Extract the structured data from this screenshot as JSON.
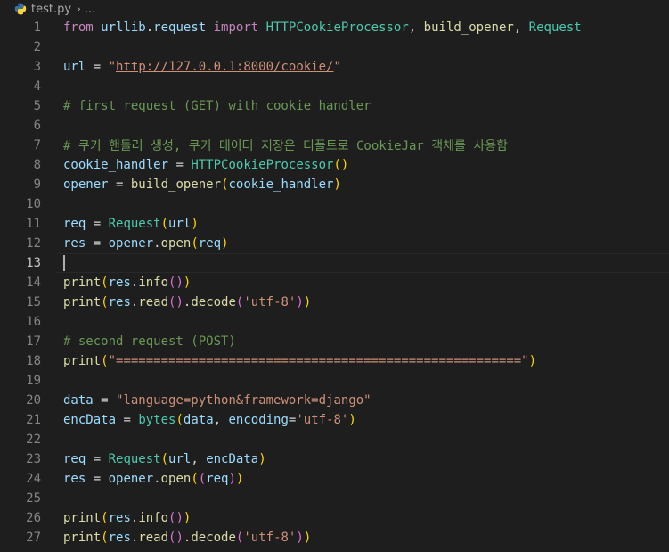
{
  "breadcrumb": {
    "file_name": "test.py",
    "separator": "›",
    "more": "..."
  },
  "theme": {
    "background": "#1e1e1e",
    "keyword": "#c586c0",
    "variable": "#9cdcfe",
    "function": "#dcdcaa",
    "class": "#4ec9b0",
    "string": "#ce9178",
    "comment": "#6a9955",
    "paren_gold": "#ffd700",
    "paren_purple": "#da70d6",
    "paren_blue": "#179fff",
    "operator": "#d4d4d4",
    "python_icon_blue": "#3572a5",
    "python_icon_yellow": "#ffd43b"
  },
  "editor": {
    "cursor_line": 13,
    "lines": [
      {
        "number": "1",
        "tokens": [
          {
            "text": "from",
            "kind": "keyword"
          },
          {
            "text": " ",
            "kind": "plain"
          },
          {
            "text": "urllib",
            "kind": "variable"
          },
          {
            "text": ".",
            "kind": "plain"
          },
          {
            "text": "request",
            "kind": "variable"
          },
          {
            "text": " ",
            "kind": "plain"
          },
          {
            "text": "import",
            "kind": "keyword"
          },
          {
            "text": " ",
            "kind": "plain"
          },
          {
            "text": "HTTPCookieProcessor",
            "kind": "class"
          },
          {
            "text": ", ",
            "kind": "plain"
          },
          {
            "text": "build_opener",
            "kind": "function"
          },
          {
            "text": ", ",
            "kind": "plain"
          },
          {
            "text": "Request",
            "kind": "class"
          }
        ]
      },
      {
        "number": "2",
        "tokens": []
      },
      {
        "number": "3",
        "tokens": [
          {
            "text": "url",
            "kind": "variable"
          },
          {
            "text": " = ",
            "kind": "plain"
          },
          {
            "text": "\"",
            "kind": "string"
          },
          {
            "text": "http://127.0.0.1:8000/cookie/",
            "kind": "string-url"
          },
          {
            "text": "\"",
            "kind": "string"
          }
        ]
      },
      {
        "number": "4",
        "tokens": []
      },
      {
        "number": "5",
        "tokens": [
          {
            "text": "# first request (GET) with cookie handler",
            "kind": "comment"
          }
        ]
      },
      {
        "number": "6",
        "tokens": []
      },
      {
        "number": "7",
        "tokens": [
          {
            "text": "# 쿠키 핸들러 생성, 쿠키 데이터 저장은 디폴트로 CookieJar 객체를 사용함",
            "kind": "comment"
          }
        ]
      },
      {
        "number": "8",
        "tokens": [
          {
            "text": "cookie_handler",
            "kind": "variable"
          },
          {
            "text": " = ",
            "kind": "plain"
          },
          {
            "text": "HTTPCookieProcessor",
            "kind": "class"
          },
          {
            "text": "()",
            "kind": "paren_gold"
          }
        ]
      },
      {
        "number": "9",
        "tokens": [
          {
            "text": "opener",
            "kind": "variable"
          },
          {
            "text": " = ",
            "kind": "plain"
          },
          {
            "text": "build_opener",
            "kind": "function"
          },
          {
            "text": "(",
            "kind": "paren_gold"
          },
          {
            "text": "cookie_handler",
            "kind": "variable"
          },
          {
            "text": ")",
            "kind": "paren_gold"
          }
        ]
      },
      {
        "number": "10",
        "tokens": []
      },
      {
        "number": "11",
        "tokens": [
          {
            "text": "req",
            "kind": "variable"
          },
          {
            "text": " = ",
            "kind": "plain"
          },
          {
            "text": "Request",
            "kind": "class"
          },
          {
            "text": "(",
            "kind": "paren_gold"
          },
          {
            "text": "url",
            "kind": "variable"
          },
          {
            "text": ")",
            "kind": "paren_gold"
          }
        ]
      },
      {
        "number": "12",
        "tokens": [
          {
            "text": "res",
            "kind": "variable"
          },
          {
            "text": " = ",
            "kind": "plain"
          },
          {
            "text": "opener",
            "kind": "variable"
          },
          {
            "text": ".",
            "kind": "plain"
          },
          {
            "text": "open",
            "kind": "function"
          },
          {
            "text": "(",
            "kind": "paren_gold"
          },
          {
            "text": "req",
            "kind": "variable"
          },
          {
            "text": ")",
            "kind": "paren_gold"
          }
        ]
      },
      {
        "number": "13",
        "tokens": []
      },
      {
        "number": "14",
        "tokens": [
          {
            "text": "print",
            "kind": "function"
          },
          {
            "text": "(",
            "kind": "paren_gold"
          },
          {
            "text": "res",
            "kind": "variable"
          },
          {
            "text": ".",
            "kind": "plain"
          },
          {
            "text": "info",
            "kind": "function"
          },
          {
            "text": "()",
            "kind": "paren_purple"
          },
          {
            "text": ")",
            "kind": "paren_gold"
          }
        ]
      },
      {
        "number": "15",
        "tokens": [
          {
            "text": "print",
            "kind": "function"
          },
          {
            "text": "(",
            "kind": "paren_gold"
          },
          {
            "text": "res",
            "kind": "variable"
          },
          {
            "text": ".",
            "kind": "plain"
          },
          {
            "text": "read",
            "kind": "function"
          },
          {
            "text": "()",
            "kind": "paren_purple"
          },
          {
            "text": ".",
            "kind": "plain"
          },
          {
            "text": "decode",
            "kind": "function"
          },
          {
            "text": "(",
            "kind": "paren_purple"
          },
          {
            "text": "'utf-8'",
            "kind": "string"
          },
          {
            "text": ")",
            "kind": "paren_purple"
          },
          {
            "text": ")",
            "kind": "paren_gold"
          }
        ]
      },
      {
        "number": "16",
        "tokens": []
      },
      {
        "number": "17",
        "tokens": [
          {
            "text": "# second request (POST)",
            "kind": "comment"
          }
        ]
      },
      {
        "number": "18",
        "tokens": [
          {
            "text": "print",
            "kind": "function"
          },
          {
            "text": "(",
            "kind": "paren_gold"
          },
          {
            "text": "\"======================================================\"",
            "kind": "string"
          },
          {
            "text": ")",
            "kind": "paren_gold"
          }
        ]
      },
      {
        "number": "19",
        "tokens": []
      },
      {
        "number": "20",
        "tokens": [
          {
            "text": "data",
            "kind": "variable"
          },
          {
            "text": " = ",
            "kind": "plain"
          },
          {
            "text": "\"language=python&framework=django\"",
            "kind": "string"
          }
        ]
      },
      {
        "number": "21",
        "tokens": [
          {
            "text": "encData",
            "kind": "variable"
          },
          {
            "text": " = ",
            "kind": "plain"
          },
          {
            "text": "bytes",
            "kind": "class"
          },
          {
            "text": "(",
            "kind": "paren_gold"
          },
          {
            "text": "data",
            "kind": "variable"
          },
          {
            "text": ", ",
            "kind": "plain"
          },
          {
            "text": "encoding",
            "kind": "variable"
          },
          {
            "text": "=",
            "kind": "plain"
          },
          {
            "text": "'utf-8'",
            "kind": "string"
          },
          {
            "text": ")",
            "kind": "paren_gold"
          }
        ]
      },
      {
        "number": "22",
        "tokens": []
      },
      {
        "number": "23",
        "tokens": [
          {
            "text": "req",
            "kind": "variable"
          },
          {
            "text": " = ",
            "kind": "plain"
          },
          {
            "text": "Request",
            "kind": "class"
          },
          {
            "text": "(",
            "kind": "paren_gold"
          },
          {
            "text": "url",
            "kind": "variable"
          },
          {
            "text": ", ",
            "kind": "plain"
          },
          {
            "text": "encData",
            "kind": "variable"
          },
          {
            "text": ")",
            "kind": "paren_gold"
          }
        ]
      },
      {
        "number": "24",
        "tokens": [
          {
            "text": "res",
            "kind": "variable"
          },
          {
            "text": " = ",
            "kind": "plain"
          },
          {
            "text": "opener",
            "kind": "variable"
          },
          {
            "text": ".",
            "kind": "plain"
          },
          {
            "text": "open",
            "kind": "function"
          },
          {
            "text": "(",
            "kind": "paren_gold"
          },
          {
            "text": "(",
            "kind": "paren_purple"
          },
          {
            "text": "req",
            "kind": "variable"
          },
          {
            "text": ")",
            "kind": "paren_purple"
          },
          {
            "text": ")",
            "kind": "paren_gold"
          }
        ]
      },
      {
        "number": "25",
        "tokens": []
      },
      {
        "number": "26",
        "tokens": [
          {
            "text": "print",
            "kind": "function"
          },
          {
            "text": "(",
            "kind": "paren_gold"
          },
          {
            "text": "res",
            "kind": "variable"
          },
          {
            "text": ".",
            "kind": "plain"
          },
          {
            "text": "info",
            "kind": "function"
          },
          {
            "text": "()",
            "kind": "paren_purple"
          },
          {
            "text": ")",
            "kind": "paren_gold"
          }
        ]
      },
      {
        "number": "27",
        "tokens": [
          {
            "text": "print",
            "kind": "function"
          },
          {
            "text": "(",
            "kind": "paren_gold"
          },
          {
            "text": "res",
            "kind": "variable"
          },
          {
            "text": ".",
            "kind": "plain"
          },
          {
            "text": "read",
            "kind": "function"
          },
          {
            "text": "()",
            "kind": "paren_purple"
          },
          {
            "text": ".",
            "kind": "plain"
          },
          {
            "text": "decode",
            "kind": "function"
          },
          {
            "text": "(",
            "kind": "paren_purple"
          },
          {
            "text": "'utf-8'",
            "kind": "string"
          },
          {
            "text": ")",
            "kind": "paren_purple"
          },
          {
            "text": ")",
            "kind": "paren_gold"
          }
        ]
      }
    ]
  }
}
